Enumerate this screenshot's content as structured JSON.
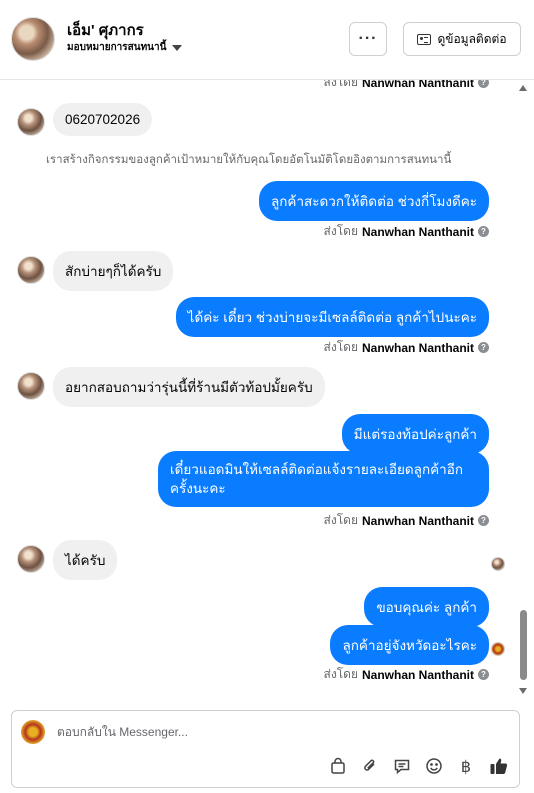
{
  "header": {
    "contact_name": "เอ็ม' ศุภากร",
    "assign_label": "มอบหมายการสนทนานี้",
    "more_label": "···",
    "contact_info_label": "ดูข้อมูลติดต่อ"
  },
  "thread": {
    "sent_by_prefix": "ส่งโดย",
    "agent_name": "Nanwhan Nanthanit",
    "info_glyph": "?",
    "messages": [
      {
        "direction": "in",
        "text": "0620702026"
      },
      {
        "direction": "system",
        "text": "เราสร้างกิจกรรมของลูกค้าเป้าหมายให้กับคุณโดยอัตโนมัติโดยอิงตามการสนทนานี้"
      },
      {
        "direction": "out",
        "text": "ลูกค้าสะดวกให้ติดต่อ ช่วงกี่โมงดีคะ"
      },
      {
        "direction": "in",
        "text": "สักบ่ายๆก็ได้ครับ"
      },
      {
        "direction": "out",
        "text": "ได้ค่ะ เดี๋ยว ช่วงบ่ายจะมีเซลล์ติดต่อ ลูกค้าไปนะคะ"
      },
      {
        "direction": "in",
        "text": "อยากสอบถามว่ารุ่นนี้ที่ร้านมีตัวท้อปมั้ยครับ"
      },
      {
        "direction": "out",
        "text": "มีแต่รองท้อปค่ะลูกค้า"
      },
      {
        "direction": "out",
        "text": "เดี๋ยวแอดมินให้เซลล์ติดต่อแจ้งรายละเอียดลูกค้าอีกครั้งนะคะ"
      },
      {
        "direction": "in",
        "text": "ได้ครับ"
      },
      {
        "direction": "out",
        "text": "ขอบคุณค่ะ ลูกค้า"
      },
      {
        "direction": "out",
        "text": "ลูกค้าอยู่จังหวัดอะไรคะ"
      }
    ]
  },
  "composer": {
    "placeholder": "ตอบกลับใน Messenger...",
    "tools": [
      "shopping-bag-icon",
      "paperclip-icon",
      "saved-reply-icon",
      "emoji-icon",
      "baht-icon",
      "thumbs-up-icon"
    ],
    "baht_glyph": "฿"
  },
  "colors": {
    "outgoing_bubble": "#0a7cff",
    "incoming_bubble": "#f0f0f0",
    "secondary_text": "#65676b"
  }
}
